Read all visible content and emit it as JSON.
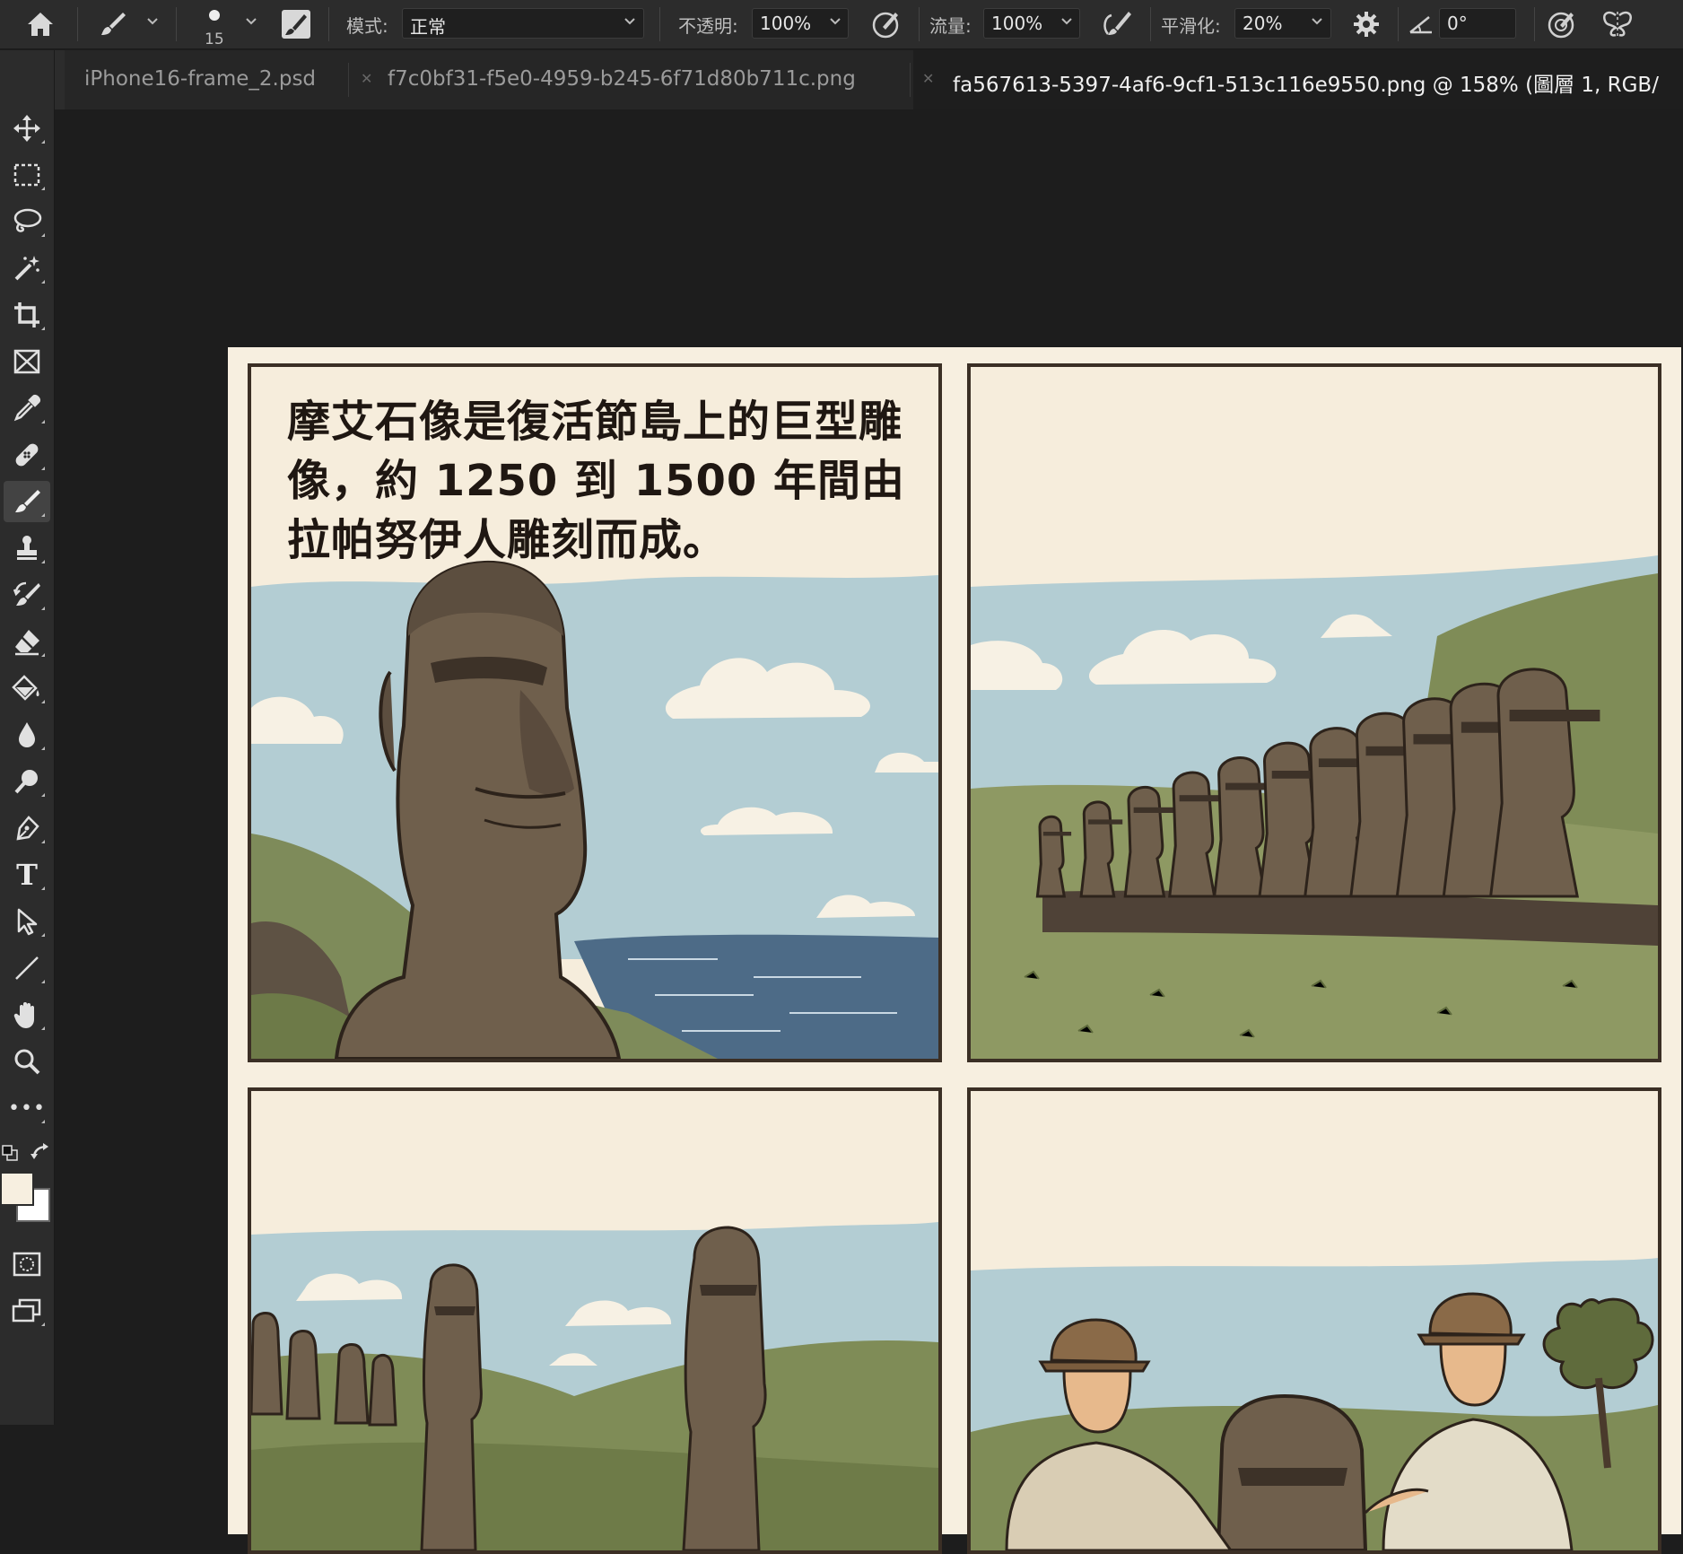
{
  "options_bar": {
    "brush_size": "15",
    "mode_label": "模式:",
    "mode_value": "正常",
    "opacity_label": "不透明:",
    "opacity_value": "100%",
    "flow_label": "流量:",
    "flow_value": "100%",
    "smoothing_label": "平滑化:",
    "smoothing_value": "20%",
    "angle_value": "0°"
  },
  "tabs": [
    {
      "label": "iPhone16-frame_2.psd",
      "active": false
    },
    {
      "label": "f7c0bf31-f5e0-4959-b245-6f71d80b711c.png",
      "active": false
    },
    {
      "label": "fa567613-5397-4af6-9cf1-513c116e9550.png @ 158% (圖層 1, RGB/",
      "active": true
    }
  ],
  "collapse_glyph": "››",
  "toolbar": {
    "tools": [
      "move-icon",
      "marquee-icon",
      "lasso-icon",
      "magic-wand-icon",
      "crop-icon",
      "frame-icon",
      "eyedropper-icon",
      "healing-brush-icon",
      "brush-icon",
      "stamp-icon",
      "history-brush-icon",
      "eraser-icon",
      "paint-bucket-icon",
      "blur-icon",
      "dodge-icon",
      "pen-icon",
      "type-icon",
      "path-select-icon",
      "line-icon",
      "hand-icon",
      "zoom-icon",
      "more-icon"
    ],
    "active_tool": "brush-icon",
    "type_glyph": "T",
    "more_glyph": "•••",
    "foreground_color": "#f7efe0",
    "background_color": "#ffffff"
  },
  "comic": {
    "caption": "摩艾石像是復活節島上的巨型雕像，約 1250 到 1500 年間由拉帕努伊人雕刻而成。"
  }
}
